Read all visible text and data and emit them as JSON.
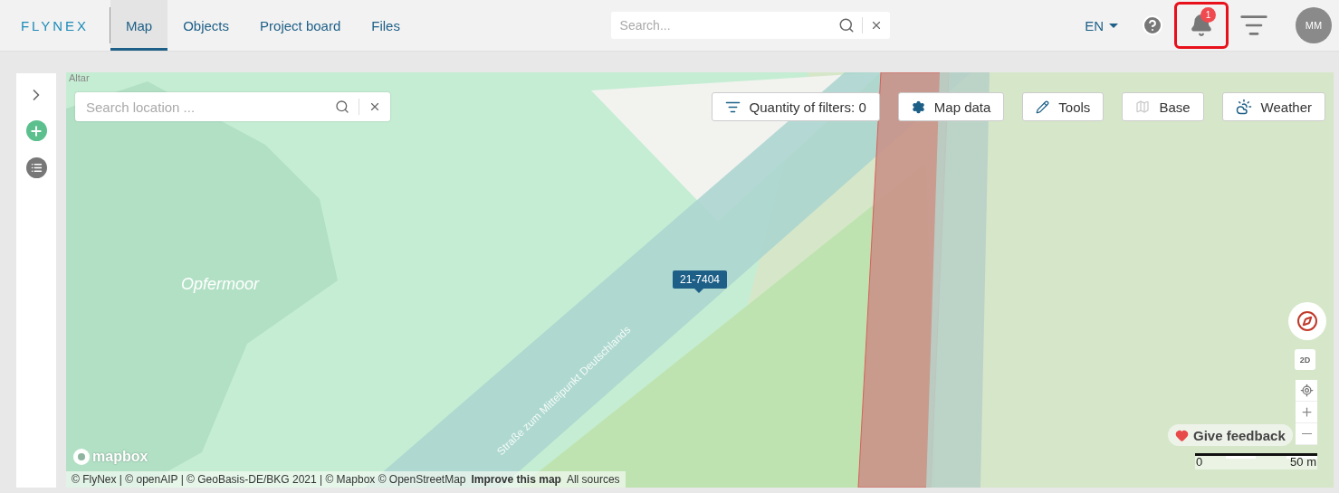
{
  "header": {
    "logo": "FLYNEX",
    "nav": [
      {
        "label": "Map",
        "selected": true
      },
      {
        "label": "Objects",
        "selected": false
      },
      {
        "label": "Project board",
        "selected": false
      },
      {
        "label": "Files",
        "selected": false
      }
    ],
    "search": {
      "placeholder": "Search..."
    },
    "language": "EN",
    "notifications": {
      "count": "1",
      "highlighted": true
    },
    "avatar": "MM"
  },
  "map": {
    "search": {
      "placeholder": "Search location ..."
    },
    "toolbar": [
      {
        "kind": "filter",
        "label": "Quantity of filters: 0"
      },
      {
        "kind": "gear",
        "label": "Map data"
      },
      {
        "kind": "pencil",
        "label": "Tools"
      },
      {
        "kind": "base",
        "label": "Base"
      },
      {
        "kind": "weather",
        "label": "Weather"
      }
    ],
    "labels": [
      {
        "kind": "edge",
        "text": "Altar"
      },
      {
        "kind": "place",
        "text": "Opfermoor"
      },
      {
        "kind": "road",
        "text": "Straße zum Mittelpunkt Deutschlands"
      }
    ],
    "marker": "21-7404",
    "mode": "2D",
    "feedback": "Give feedback",
    "scale": {
      "start": "0",
      "end": "50 m"
    },
    "brand": "mapbox",
    "attribution": [
      {
        "kind": "plain",
        "text": "© FlyNex | © openAIP | © GeoBasis-DE/BKG 2021 | © Mapbox © OpenStreetMap"
      },
      {
        "kind": "link",
        "text": "Improve this map"
      },
      {
        "kind": "plain",
        "text": "All sources"
      }
    ]
  }
}
